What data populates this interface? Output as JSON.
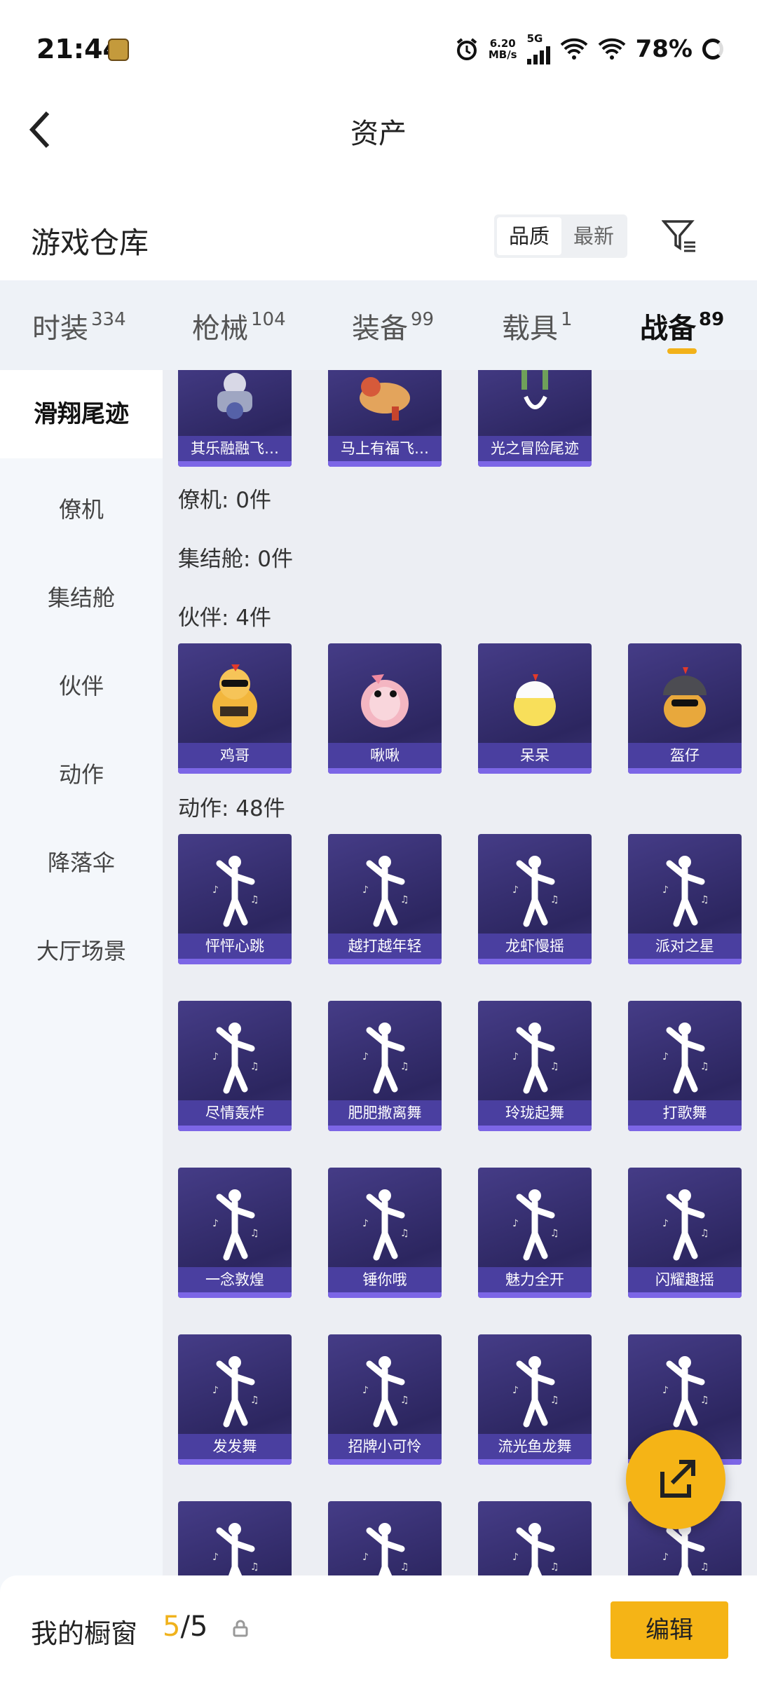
{
  "status_bar": {
    "time": "21:44",
    "speed_value": "6.20",
    "speed_unit": "MB/s",
    "network": "5G",
    "battery": "78%"
  },
  "header": {
    "title": "资产"
  },
  "warehouse": {
    "title": "游戏仓库",
    "sort_options": [
      "品质",
      "最新"
    ],
    "selected_sort": "品质"
  },
  "tabs": [
    {
      "label": "时装",
      "count": "334"
    },
    {
      "label": "枪械",
      "count": "104"
    },
    {
      "label": "装备",
      "count": "99"
    },
    {
      "label": "载具",
      "count": "1"
    },
    {
      "label": "战备",
      "count": "89",
      "active": true
    }
  ],
  "sidebar": {
    "items": [
      "滑翔尾迹",
      "僚机",
      "集结舱",
      "伙伴",
      "动作",
      "降落伞",
      "大厅场景"
    ],
    "active": "滑翔尾迹"
  },
  "sections": {
    "glide_items": [
      "其乐融融飞…",
      "马上有福飞…",
      "光之冒险尾迹"
    ],
    "wingman": "僚机: 0件",
    "rally": "集结舱: 0件",
    "partner": "伙伴: 4件",
    "partner_items": [
      "鸡哥",
      "啾啾",
      "呆呆",
      "盔仔"
    ],
    "emote": "动作: 48件",
    "emote_items": [
      "怦怦心跳",
      "越打越年轻",
      "龙虾慢摇",
      "派对之星",
      "尽情轰炸",
      "肥肥撒离舞",
      "玲珑起舞",
      "打歌舞",
      "一念敦煌",
      "锤你哦",
      "魅力全开",
      "闪耀趣摇",
      "发发舞",
      "招牌小可怜",
      "流光鱼龙舞",
      "",
      "",
      "",
      "",
      ""
    ]
  },
  "bottom": {
    "label": "我的橱窗",
    "count_current": "5",
    "count_sep": "/",
    "count_total": "5",
    "edit_label": "编辑"
  },
  "colors": {
    "accent": "#f5b416",
    "card_bg": "#2c2660",
    "card_label": "#4a3fa0"
  }
}
